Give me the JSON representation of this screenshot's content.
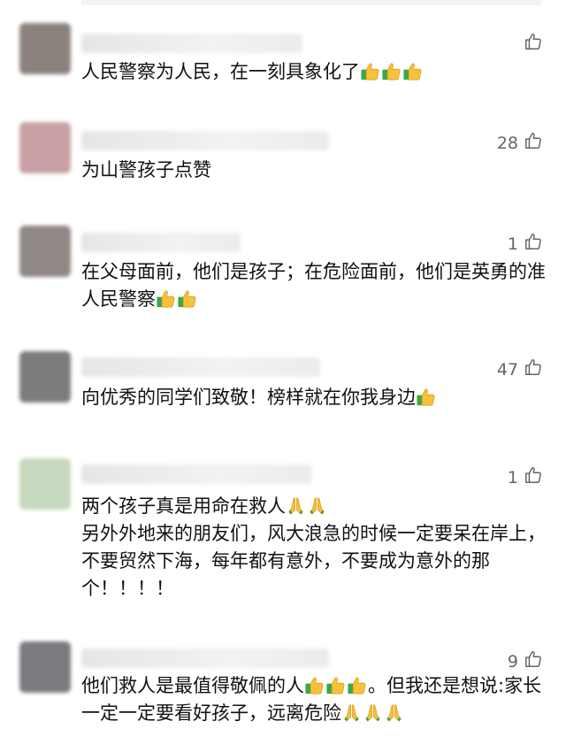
{
  "comments": [
    {
      "likes": "",
      "segments": [
        {
          "t": "人民警察为人民，在一刻具象化了"
        },
        {
          "e": "thumbs-up"
        },
        {
          "e": "thumbs-up"
        },
        {
          "e": "thumbs-up"
        }
      ]
    },
    {
      "likes": "28",
      "segments": [
        {
          "t": "为山警孩子点赞"
        }
      ]
    },
    {
      "likes": "1",
      "segments": [
        {
          "t": "在父母面前，他们是孩子；在危险面前，他们是英勇的准人民警察"
        },
        {
          "e": "thumbs-up"
        },
        {
          "e": "thumbs-up"
        }
      ]
    },
    {
      "likes": "47",
      "segments": [
        {
          "t": "向优秀的同学们致敬！榜样就在你我身边"
        },
        {
          "e": "thumbs-up"
        }
      ]
    },
    {
      "likes": "1",
      "segments": [
        {
          "t": "两个孩子真是用命在救人"
        },
        {
          "e": "folded-hands"
        },
        {
          "e": "folded-hands"
        },
        {
          "br": true
        },
        {
          "t": "另外外地来的朋友们，风大浪急的时候一定要呆在岸上，不要贸然下海，每年都有意外，不要成为意外的那个！！！！"
        }
      ]
    },
    {
      "likes": "9",
      "segments": [
        {
          "t": "他们救人是最值得敬佩的人"
        },
        {
          "e": "thumbs-up"
        },
        {
          "e": "thumbs-up"
        },
        {
          "e": "thumbs-up"
        },
        {
          "t": "。但我还是想说:家长一定一定要看好孩子，远离危险"
        },
        {
          "e": "folded-hands"
        },
        {
          "e": "folded-hands"
        },
        {
          "e": "folded-hands"
        }
      ]
    }
  ],
  "colors": {
    "avatars": [
      "#8b827e",
      "#c9a0a4",
      "#8f8885",
      "#7d7b7c",
      "#c6d8bd",
      "#7b7b7f"
    ],
    "like_text": "#666666",
    "comment_text": "#111111"
  }
}
